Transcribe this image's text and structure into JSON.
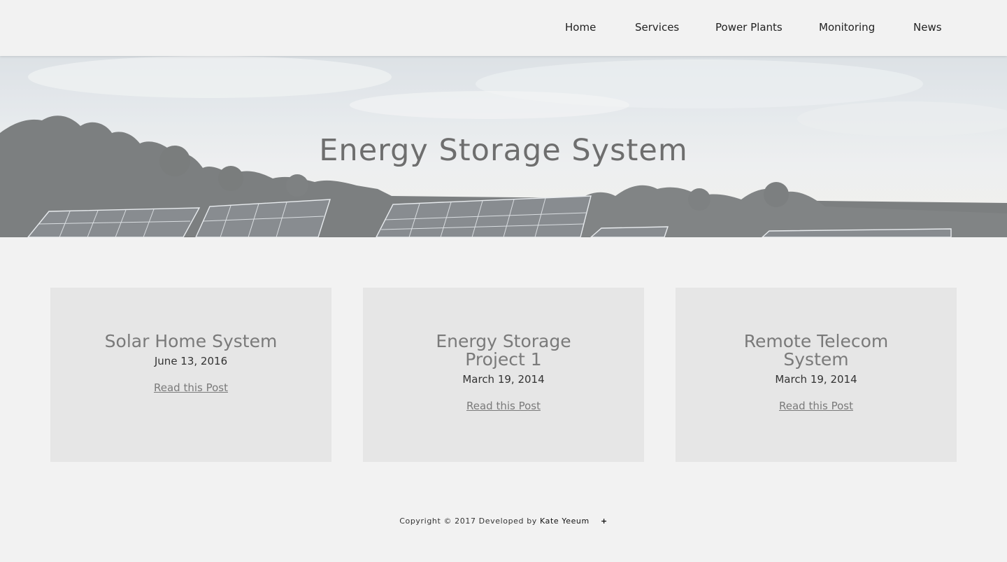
{
  "nav": {
    "items": [
      {
        "label": "Home"
      },
      {
        "label": "Services"
      },
      {
        "label": "Power Plants"
      },
      {
        "label": "Monitoring"
      },
      {
        "label": "News"
      }
    ]
  },
  "hero": {
    "title": "Energy Storage System"
  },
  "posts": [
    {
      "title": "Solar Home System",
      "date": "June 13, 2016",
      "link": "Read this Post"
    },
    {
      "title": "Energy Storage Project 1",
      "date": "March 19, 2014",
      "link": "Read this Post"
    },
    {
      "title": "Remote Telecom System",
      "date": "March 19, 2014",
      "link": "Read this Post"
    }
  ],
  "footer": {
    "text": "Copyright © 2017 Developed by",
    "author": "Kate Yeeum",
    "plus": "+"
  },
  "colors": {
    "background": "#f2f2f2",
    "card": "#e6e6e6",
    "title_gray": "#7a7a7a"
  }
}
